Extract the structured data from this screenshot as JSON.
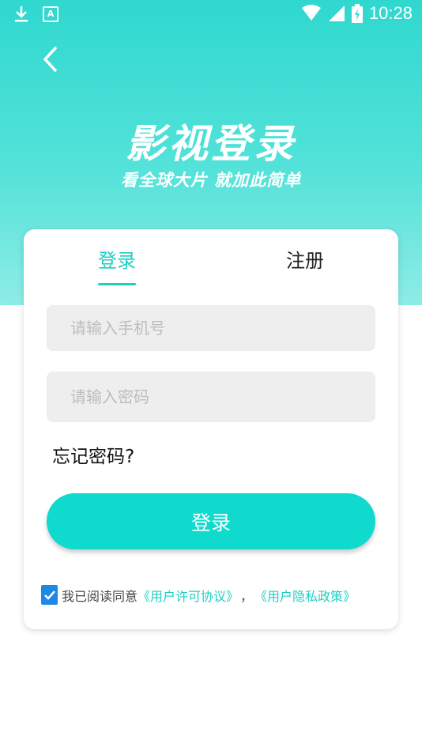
{
  "status_bar": {
    "time": "10:28",
    "icons": [
      "download-icon",
      "app-notification-icon",
      "wifi-icon",
      "signal-icon",
      "battery-charging-icon"
    ]
  },
  "header": {
    "back_icon": "back-chevron-icon",
    "title": "影视登录",
    "subtitle": "看全球大片 就加此简单"
  },
  "tabs": [
    {
      "label": "登录",
      "active": true
    },
    {
      "label": "注册",
      "active": false
    }
  ],
  "form": {
    "phone_placeholder": "请输入手机号",
    "password_placeholder": "请输入密码",
    "forgot_label": "忘记密码?",
    "login_button": "登录"
  },
  "agreement": {
    "checked": true,
    "text": "我已阅读同意",
    "user_license": "《用户许可协议》",
    "separator": "，",
    "privacy_policy": "《用户隐私政策》"
  },
  "colors": {
    "accent": "#10dace",
    "hero_top": "#2fd8cf",
    "hero_bottom": "#8eece6",
    "checkbox": "#1e88e5"
  }
}
